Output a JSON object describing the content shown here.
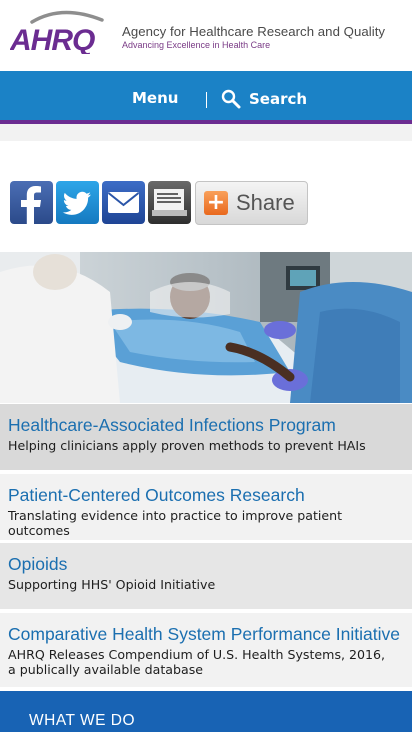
{
  "header": {
    "logo_text": "AHRQ",
    "agency_name": "Agency for Healthcare Research and Quality",
    "tagline": "Advancing Excellence in Health Care"
  },
  "nav": {
    "menu_label": "Menu",
    "search_label": "Search"
  },
  "social": {
    "share_label": "Share",
    "icons": [
      "facebook-icon",
      "twitter-icon",
      "email-icon",
      "print-icon",
      "plus-icon"
    ]
  },
  "features": [
    {
      "title": "Healthcare-Associated Infections Program",
      "desc": "Helping clinicians apply proven methods to prevent HAIs"
    },
    {
      "title": "Patient-Centered Outcomes Research",
      "desc": "Translating evidence into practice to improve patient outcomes"
    },
    {
      "title": "Opioids",
      "desc": "Supporting HHS' Opioid Initiative"
    },
    {
      "title": "Comparative Health System Performance Initiative",
      "desc": "AHRQ Releases Compendium of U.S. Health Systems, 2016, a publically available database"
    }
  ],
  "what_we_do": "WHAT WE DO",
  "colors": {
    "nav_blue": "#1b82c6",
    "accent_purple": "#6b2c91",
    "link_blue": "#1b6fb0",
    "footer_blue": "#1863b4"
  }
}
